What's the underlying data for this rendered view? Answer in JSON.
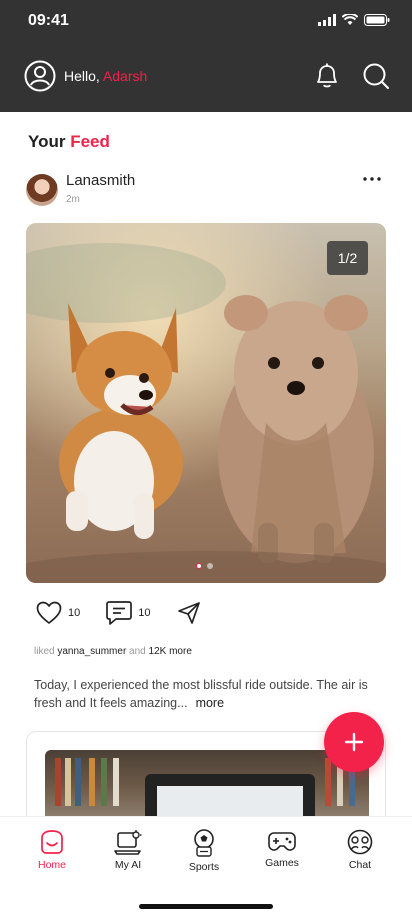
{
  "status_bar": {
    "time": "09:41"
  },
  "header": {
    "greeting_prefix": "Hello, ",
    "user_name": "Adarsh",
    "icons": [
      "user-avatar-icon",
      "bell-icon",
      "search-icon"
    ]
  },
  "feed": {
    "title_prefix": "Your ",
    "title_accent": "Feed"
  },
  "post": {
    "username": "Lanasmith",
    "time_ago": "2m",
    "image_counter": "1/2",
    "likes": "10",
    "comments": "10",
    "liked_prefix": "liked ",
    "liked_user": "yanna_summer",
    "liked_mid": " and ",
    "liked_more": "12K more",
    "caption": "Today, I experienced the most blissful ride outside. The air is fresh and It feels amazing...",
    "more_label": "more"
  },
  "bottom_nav": {
    "items": [
      {
        "label": "Home",
        "icon": "home-icon",
        "active": true
      },
      {
        "label": "My AI",
        "icon": "ai-icon",
        "active": false
      },
      {
        "label": "Sports",
        "icon": "sports-icon",
        "active": false
      },
      {
        "label": "Games",
        "icon": "gamepad-icon",
        "active": false
      },
      {
        "label": "Chat",
        "icon": "chat-icon",
        "active": false
      }
    ]
  },
  "colors": {
    "accent": "#F2224A",
    "header_bg": "#333333"
  }
}
